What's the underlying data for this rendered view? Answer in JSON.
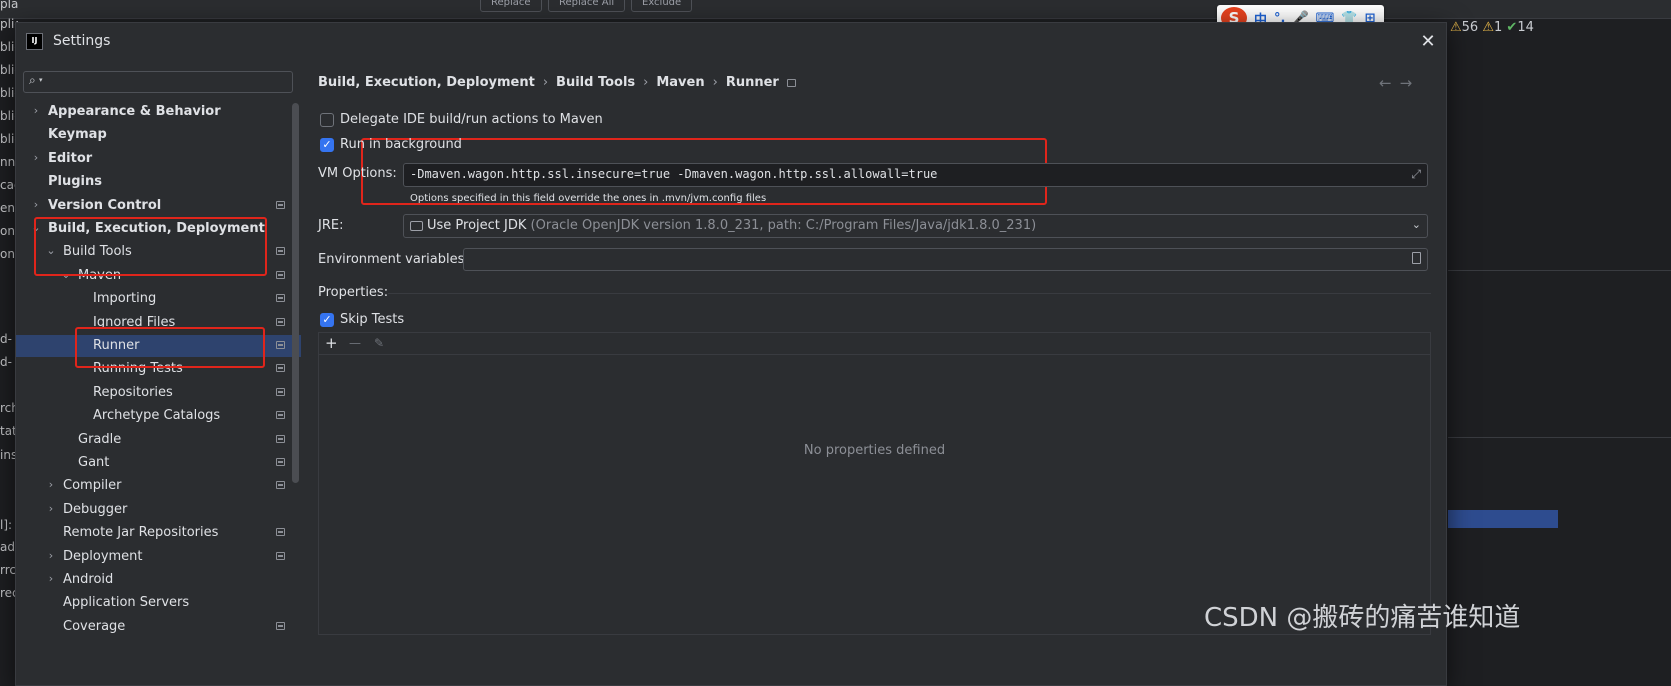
{
  "background": {
    "left_fragments": [
      "plates",
      "plication.yml",
      "blic",
      "blic",
      "blic",
      "blic",
      "blic",
      "nne",
      "cad",
      "en",
      "onn",
      "onn",
      "d-",
      "d-",
      "rch",
      "tat",
      "ins",
      "l]:",
      "ad",
      "rrc",
      "rec"
    ],
    "toolbar_buttons": [
      "Replace",
      "Replace All",
      "Exclude"
    ],
    "status": {
      "warnings": "56",
      "weak_warnings": "1",
      "ok_count": "14"
    }
  },
  "ime": {
    "logo": "S",
    "items": [
      "中",
      "°,",
      "🎤",
      "⌨",
      "👕",
      "⊞"
    ]
  },
  "dialog": {
    "title": "Settings",
    "search_placeholder": "",
    "tree": [
      {
        "label": "Appearance & Behavior",
        "bold": true,
        "arrow": "›",
        "proj": false
      },
      {
        "label": "Keymap",
        "bold": true,
        "arrow": "",
        "proj": false
      },
      {
        "label": "Editor",
        "bold": true,
        "arrow": "›",
        "proj": false
      },
      {
        "label": "Plugins",
        "bold": true,
        "arrow": "",
        "proj": false
      },
      {
        "label": "Version Control",
        "bold": true,
        "arrow": "›",
        "proj": true
      },
      {
        "label": "Build, Execution, Deployment",
        "bold": true,
        "arrow": "⌄",
        "proj": false
      },
      {
        "label": "Build Tools",
        "bold": false,
        "arrow": "⌄",
        "proj": true
      },
      {
        "label": "Maven",
        "bold": false,
        "arrow": "⌄",
        "proj": true
      },
      {
        "label": "Importing",
        "bold": false,
        "arrow": "",
        "proj": true
      },
      {
        "label": "Ignored Files",
        "bold": false,
        "arrow": "",
        "proj": true
      },
      {
        "label": "Runner",
        "bold": false,
        "arrow": "",
        "proj": true,
        "selected": true
      },
      {
        "label": "Running Tests",
        "bold": false,
        "arrow": "",
        "proj": true
      },
      {
        "label": "Repositories",
        "bold": false,
        "arrow": "",
        "proj": true
      },
      {
        "label": "Archetype Catalogs",
        "bold": false,
        "arrow": "",
        "proj": true
      },
      {
        "label": "Gradle",
        "bold": false,
        "arrow": "",
        "proj": true
      },
      {
        "label": "Gant",
        "bold": false,
        "arrow": "",
        "proj": true
      },
      {
        "label": "Compiler",
        "bold": false,
        "arrow": "›",
        "proj": true
      },
      {
        "label": "Debugger",
        "bold": false,
        "arrow": "›",
        "proj": false
      },
      {
        "label": "Remote Jar Repositories",
        "bold": false,
        "arrow": "",
        "proj": true
      },
      {
        "label": "Deployment",
        "bold": false,
        "arrow": "›",
        "proj": true
      },
      {
        "label": "Android",
        "bold": false,
        "arrow": "›",
        "proj": false
      },
      {
        "label": "Application Servers",
        "bold": false,
        "arrow": "",
        "proj": false
      },
      {
        "label": "Coverage",
        "bold": false,
        "arrow": "",
        "proj": true
      }
    ],
    "breadcrumb": [
      "Build, Execution, Deployment",
      "Build Tools",
      "Maven",
      "Runner"
    ],
    "nav": {
      "back": "←",
      "forward": "→"
    },
    "runner": {
      "delegate_label": "Delegate IDE build/run actions to Maven",
      "delegate_checked": false,
      "background_label": "Run in background",
      "background_checked": true,
      "vm_options_label": "VM Options:",
      "vm_options_value": "-Dmaven.wagon.http.ssl.insecure=true -Dmaven.wagon.http.ssl.allowall=true",
      "vm_options_hint": "Options specified in this field override the ones in .mvn/jvm.config files",
      "jre_label": "JRE:",
      "jre_value": "Use Project JDK",
      "jre_detail": "(Oracle OpenJDK version 1.8.0_231, path: C:/Program Files/Java/jdk1.8.0_231)",
      "env_label": "Environment variables:",
      "env_value": "",
      "properties_label": "Properties:",
      "skip_tests_label": "Skip Tests",
      "skip_tests_checked": true,
      "props_add": "+",
      "props_remove": "—",
      "props_edit": "✎",
      "props_empty": "No properties defined"
    }
  },
  "watermark": "CSDN @搬砖的痛苦谁知道"
}
